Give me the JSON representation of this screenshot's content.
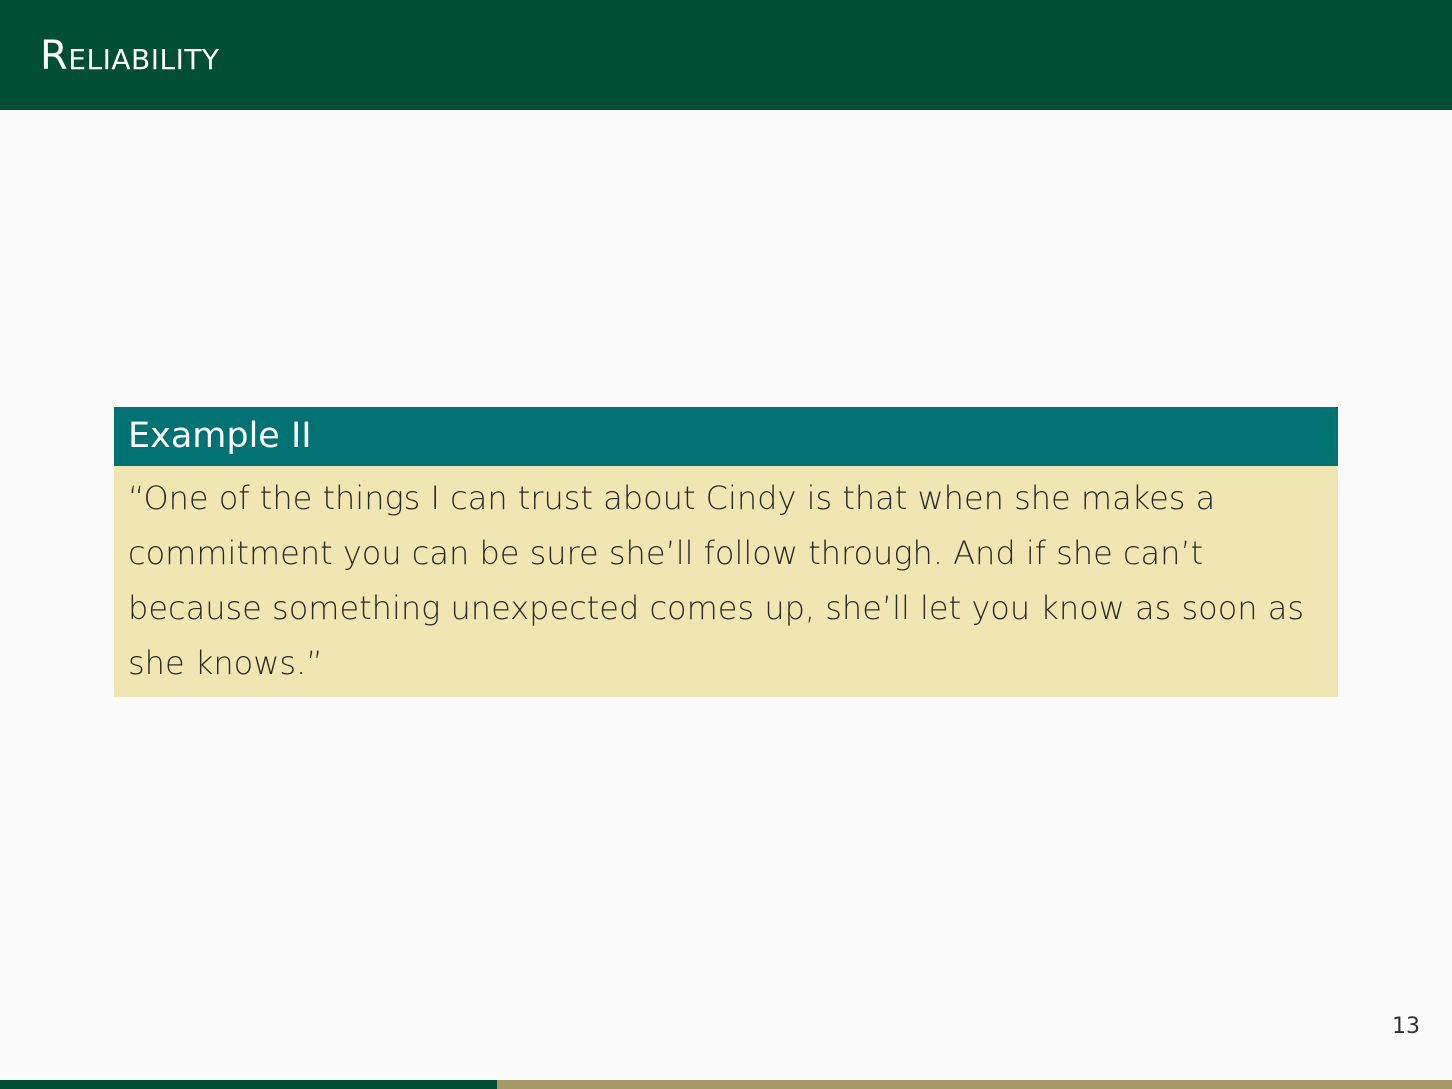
{
  "slide": {
    "title": "Reliability",
    "page_number": "13",
    "progress": 0.342
  },
  "block": {
    "title": "Example II",
    "body": "“One of the things I can trust about Cindy is that when she makes a commitment you can be sure she’ll follow through.  And if she can’t because something unexpected comes up, she’ll let you know as soon as she knows.”"
  },
  "colors": {
    "header_bg": "#004f35",
    "block_title_bg": "#007273",
    "block_body_bg": "#f0e6b2",
    "progress_fill": "#004f35",
    "progress_track": "#a79a67"
  }
}
